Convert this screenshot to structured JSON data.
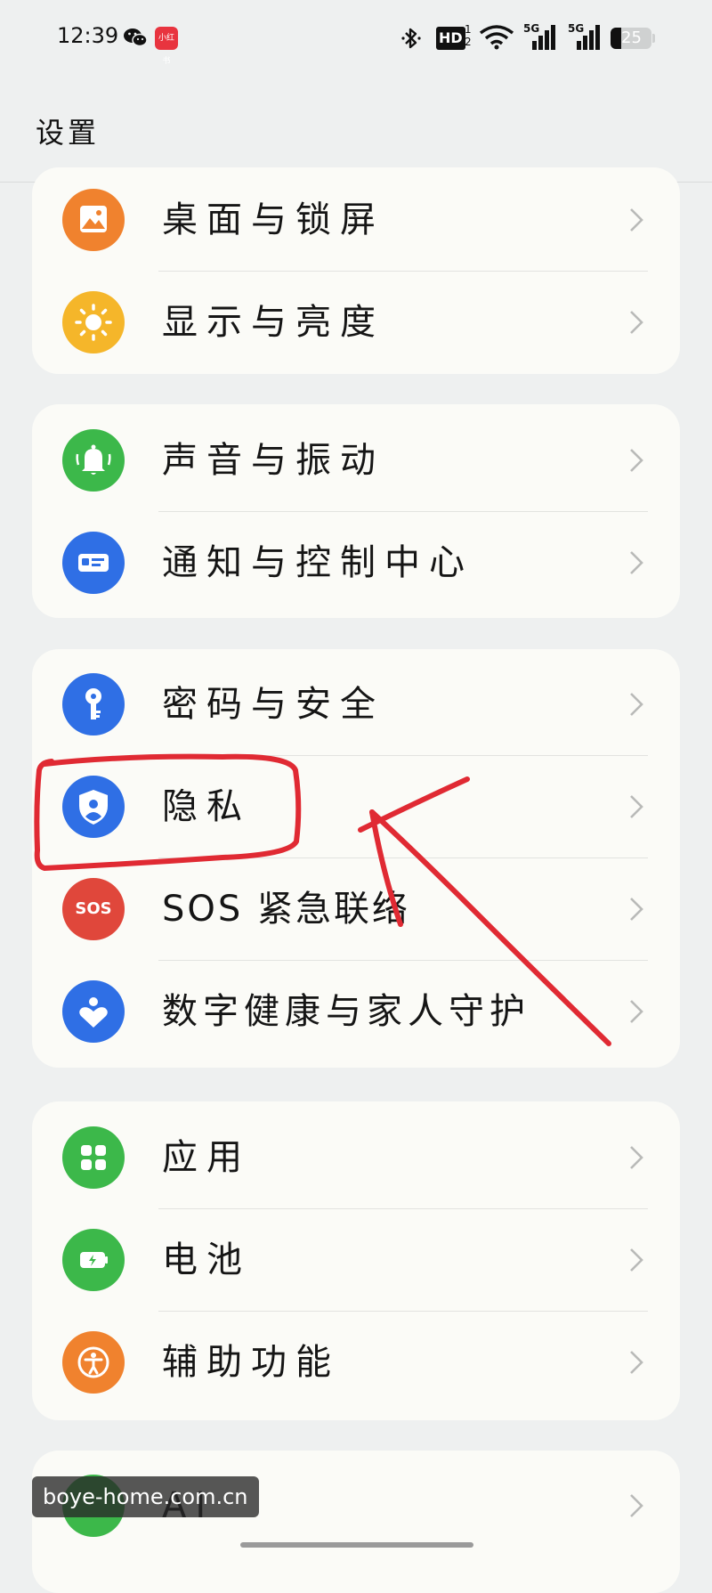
{
  "status_bar": {
    "time": "12:39",
    "xhs_badge": "小红书",
    "hd": "HD",
    "hd_sub": "1\n2",
    "sig1_label": "5G",
    "sig2_label": "5G",
    "battery": "25",
    "battery_level": 0.25
  },
  "header": {
    "title": "设置"
  },
  "groups": [
    {
      "items": [
        {
          "label": "桌面与锁屏",
          "icon": "wallpaper-icon",
          "color": "#f0822e"
        },
        {
          "label": "显示与亮度",
          "icon": "sun-icon",
          "color": "#f5b62a"
        }
      ]
    },
    {
      "items": [
        {
          "label": "声音与振动",
          "icon": "bell-icon",
          "color": "#3cb84a"
        },
        {
          "label": "通知与控制中心",
          "icon": "notification-icon",
          "color": "#2f6fe5"
        }
      ]
    },
    {
      "items": [
        {
          "label": "密码与安全",
          "icon": "key-icon",
          "color": "#2f6fe5"
        },
        {
          "label": "隐私",
          "icon": "privacy-shield-icon",
          "color": "#2f6fe5"
        },
        {
          "label": "SOS 紧急联络",
          "icon": "sos-icon",
          "color": "#e0473b",
          "icon_text": "SOS"
        },
        {
          "label": "数字健康与家人守护",
          "icon": "heart-person-icon",
          "color": "#2f6fe5"
        }
      ]
    },
    {
      "items": [
        {
          "label": "应用",
          "icon": "apps-grid-icon",
          "color": "#3cb84a"
        },
        {
          "label": "电池",
          "icon": "battery-icon",
          "color": "#3cb84a"
        },
        {
          "label": "辅助功能",
          "icon": "accessibility-icon",
          "color": "#f0822e"
        }
      ]
    },
    {
      "items": [
        {
          "label": "AI",
          "icon": "ai-icon",
          "color": "#3cb84a"
        }
      ]
    }
  ],
  "watermark": "boye-home.com.cn"
}
